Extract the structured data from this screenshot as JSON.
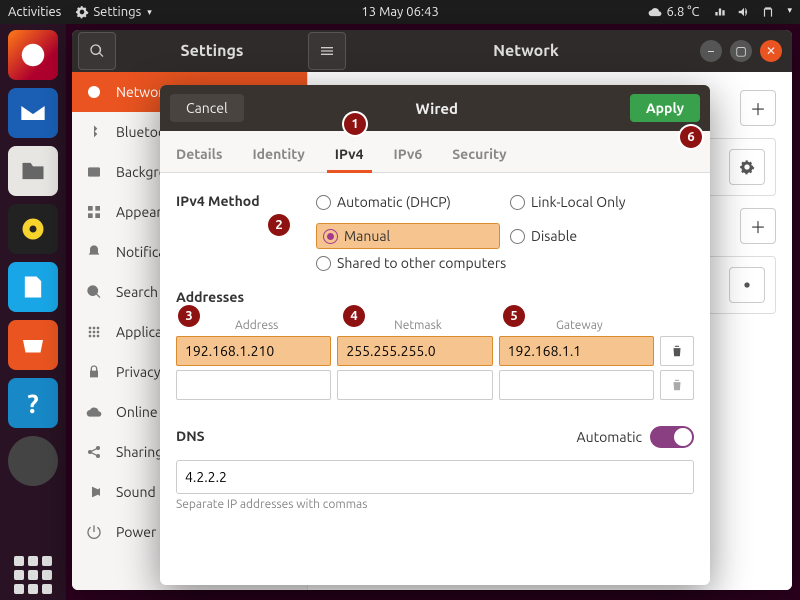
{
  "menubar": {
    "activities": "Activities",
    "app_label": "Settings",
    "clock": "13 May  06:43",
    "weather": "6.8 °C"
  },
  "dock": {
    "items": [
      "firefox",
      "thunderbird",
      "files",
      "rhythmbox",
      "libreoffice",
      "ubuntu-software",
      "help"
    ]
  },
  "settings": {
    "window_title_left": "Settings",
    "window_title_right": "Network",
    "sidebar": {
      "items": [
        {
          "icon": "globe",
          "label": "Network"
        },
        {
          "icon": "bluetooth",
          "label": "Bluetooth"
        },
        {
          "icon": "background",
          "label": "Background"
        },
        {
          "icon": "grid",
          "label": "Appearance"
        },
        {
          "icon": "bell",
          "label": "Notifications"
        },
        {
          "icon": "search",
          "label": "Search"
        },
        {
          "icon": "apps",
          "label": "Applications"
        },
        {
          "icon": "lock",
          "label": "Privacy"
        },
        {
          "icon": "cloud",
          "label": "Online Accounts"
        },
        {
          "icon": "share",
          "label": "Sharing"
        },
        {
          "icon": "sound",
          "label": "Sound"
        },
        {
          "icon": "power",
          "label": "Power"
        }
      ]
    }
  },
  "dialog": {
    "cancel": "Cancel",
    "title": "Wired",
    "apply": "Apply",
    "tabs": [
      "Details",
      "Identity",
      "IPv4",
      "IPv6",
      "Security"
    ],
    "active_tab": "IPv4",
    "ipv4": {
      "method_label": "IPv4 Method",
      "methods": {
        "auto": "Automatic (DHCP)",
        "linklocal": "Link-Local Only",
        "manual": "Manual",
        "disable": "Disable",
        "shared": "Shared to other computers"
      },
      "addresses_label": "Addresses",
      "cols": {
        "address": "Address",
        "netmask": "Netmask",
        "gateway": "Gateway"
      },
      "row": {
        "address": "192.168.1.210",
        "netmask": "255.255.255.0",
        "gateway": "192.168.1.1"
      },
      "dns_label": "DNS",
      "dns_auto_label": "Automatic",
      "dns_value": "4.2.2.2",
      "dns_note": "Separate IP addresses with commas"
    }
  },
  "callouts": [
    "1",
    "2",
    "3",
    "4",
    "5",
    "6"
  ]
}
